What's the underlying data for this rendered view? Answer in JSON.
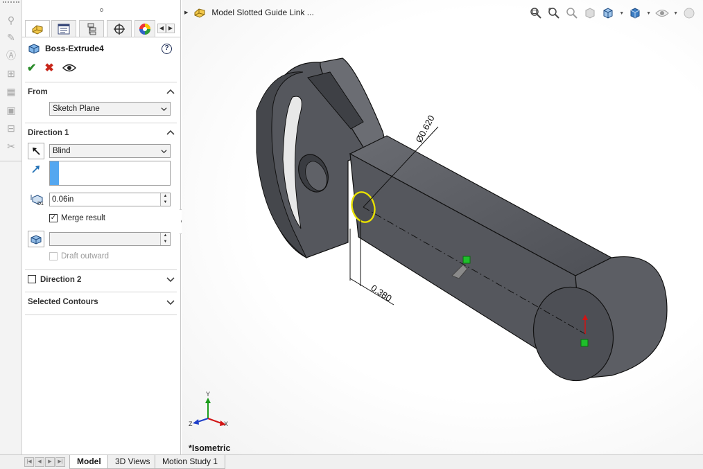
{
  "tree": {
    "item_label": "Model Slotted Guide Link ..."
  },
  "feature": {
    "title": "Boss-Extrude4",
    "help_label": "?"
  },
  "actions": {
    "ok_label": "✔",
    "cancel_label": "✖"
  },
  "from": {
    "header": "From",
    "selected": "Sketch Plane"
  },
  "direction1": {
    "header": "Direction 1",
    "end_condition": "Blind",
    "depth_value": "0.06in",
    "merge_result_label": "Merge result",
    "merge_result_checked": true,
    "draft_outward_label": "Draft outward",
    "draft_outward_checked": false,
    "draft_value": ""
  },
  "direction2": {
    "header": "Direction 2",
    "enabled": false
  },
  "selected_contours": {
    "header": "Selected Contours"
  },
  "viewport": {
    "view_label": "*Isometric",
    "dim_diameter": "Ø0.620",
    "dim_length": "0.380",
    "triad": {
      "x": "X",
      "y": "Y",
      "z": "Z"
    }
  },
  "bottom_tabs": [
    {
      "label": "Model",
      "active": true
    },
    {
      "label": "3D Views",
      "active": false
    },
    {
      "label": "Motion Study 1",
      "active": false
    }
  ],
  "colors": {
    "model_gray": "#55575d",
    "selection_blue": "#54a7f0",
    "ok_green": "#2a8b2a",
    "cancel_red": "#c8261a",
    "highlight_yellow": "#e8e000"
  },
  "icons": {
    "tool_strip": [
      "smart-dimension-icon",
      "note-icon",
      "balloon-icon",
      "tolerance-icon",
      "surface-finish-icon",
      "weld-icon",
      "datum-icon",
      "geometric-tolerance-icon"
    ],
    "hud": [
      "zoom-to-fit-icon",
      "zoom-area-icon",
      "previous-view-icon",
      "section-view-icon",
      "view-orientation-icon",
      "display-style-icon",
      "hide-show-icon",
      "appearance-icon"
    ]
  }
}
